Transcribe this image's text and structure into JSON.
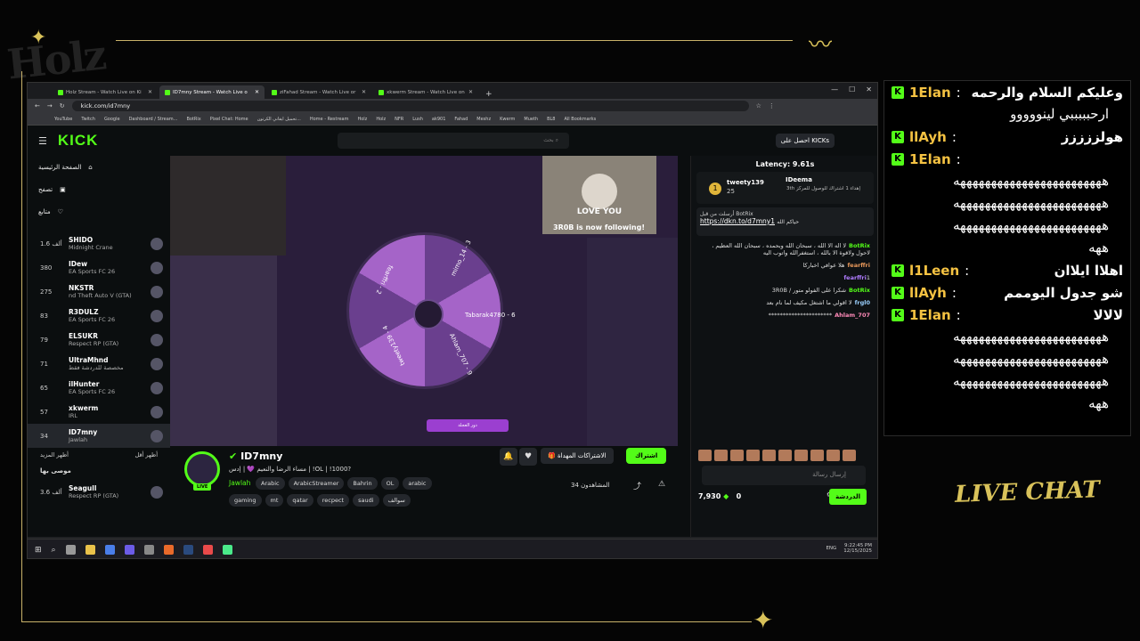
{
  "overlay_brand": {
    "logo_text": "Holz",
    "live_chat_label": "LIVE CHAT"
  },
  "browser": {
    "tabs": [
      {
        "label": "Holz Stream - Watch Live on Ki"
      },
      {
        "label": "ID7mny Stream - Watch Live o"
      },
      {
        "label": "ziFahad Stream - Watch Live or"
      },
      {
        "label": "xkwerm Stream - Watch Live on"
      }
    ],
    "url": "kick.com/id7mny",
    "bookmarks": [
      "YouTube",
      "Twitch",
      "Google",
      "Dashboard / Stream...",
      "BotRix",
      "Pixel Chat: Home",
      "تحميل ايقاني الكرتون...",
      "Home - Restream",
      "Holz",
      "Holz",
      "NFR",
      "Lush",
      "ak901",
      "Fahad",
      "Meshz",
      "Kwerm",
      "Mueth",
      "BL8",
      "All Bookmarks"
    ]
  },
  "kick": {
    "logo": "KICK",
    "search_placeholder": "بحث",
    "get_kicks": "احصل على KICKs",
    "nav": [
      {
        "label": "الصفحة الرئيسية",
        "icon": "home-icon"
      },
      {
        "label": "تصفح",
        "icon": "browse-icon"
      },
      {
        "label": "متابع",
        "icon": "heart-icon"
      }
    ],
    "following_channels": [
      {
        "name": "SHIDO",
        "game": "Midnight Crane",
        "viewers": "1.6 ألف"
      },
      {
        "name": "IDew",
        "game": "EA Sports FC 26",
        "viewers": "380"
      },
      {
        "name": "NKSTR",
        "game": "nd Theft Auto V (GTA)",
        "viewers": "275"
      },
      {
        "name": "R3DULZ",
        "game": "EA Sports FC 26",
        "viewers": "83"
      },
      {
        "name": "ELSUKR",
        "game": "Respect RP (GTA)",
        "viewers": "79"
      },
      {
        "name": "UltraMhnd",
        "game": "مخصصة للدردشة فقط",
        "viewers": "71"
      },
      {
        "name": "ilHunter",
        "game": "EA Sports FC 26",
        "viewers": "65"
      },
      {
        "name": "xkwerm",
        "game": "IRL",
        "viewers": "57"
      },
      {
        "name": "ID7mny",
        "game": "Jawlah",
        "viewers": "34"
      }
    ],
    "show_more": "أظهر المزيد",
    "show_less": "أظهر أقل",
    "recommended_label": "موصى بها",
    "recommended": [
      {
        "name": "Seagull",
        "game": "Respect RP (GTA)",
        "viewers": "3.6 ألف"
      }
    ],
    "video": {
      "cat_caption": "LOVE YOU",
      "follow_alert": "3R0B is now following!",
      "wheel_segments": [
        "mimo_14 - 3",
        "Tabarak4780 - 6",
        "Ahlam_707 - 9",
        "tweety139 - 4",
        "fearffri - 2"
      ],
      "spin_button": "دور العجلة"
    },
    "stream": {
      "channel_name": "ID7mny",
      "live_badge": "LIVE",
      "title": "مساء الرضا والنعيم 💜 | إدس | !OL | !1000?",
      "category": "Jawlah",
      "tags": [
        "Arabic",
        "ArabicStreamer",
        "Bahrin",
        "OL",
        "arabic",
        "gaming",
        "mt",
        "qatar",
        "recpect",
        "saudi",
        "سوالف"
      ],
      "subscribe": "اشتراك",
      "gift_subs": "الاشتراكات المهداة",
      "viewers": "34 المشاهدون"
    },
    "chat": {
      "latency": "Latency: 9.61s",
      "leaderboard": {
        "first": "tweety139",
        "first_count": "25",
        "second": "IDeema",
        "second_note": "إهداء 1 اشتراك للوصول للمركز 3th",
        "rank": "1"
      },
      "pinned_by": "أرسلت من قبل BotRix",
      "pinned_link": "https://dkn.to/d7mny1",
      "pinned_suffix": "حياكم الله",
      "messages": [
        {
          "user": "BotRix",
          "text": "لا اله الا الله ، سبحان الله وبحمده ، سبحان الله العظيم ، لاحول ولاقوة الا بالله ، استغفرالله واتوب اليه",
          "color": "#53fc18"
        },
        {
          "user": "fearffri",
          "text": "هلا عوافي اخباركا",
          "color": "#e8985a"
        },
        {
          "user": "fearffri",
          "text": "1",
          "color": "#b07cff"
        },
        {
          "user": "BotRix",
          "text": "شكرا على الفولو متور / 3R0B",
          "color": "#53fc18"
        },
        {
          "user": "frgl0",
          "text": "لا اقولي ما اشتغل مكيف لما نام بعد",
          "color": "#9ad0ff"
        },
        {
          "user": "Ahlam_707",
          "text": "**********************",
          "color": "#ff8ab8"
        }
      ],
      "input_placeholder": "إرسال رسالة",
      "points": "7,930",
      "zero": "0",
      "chat_button": "الدردشة"
    }
  },
  "taskbar": {
    "lang": "ENG",
    "time": "9:22:45 PM",
    "date": "12/15/2025"
  },
  "overlay_chat": [
    {
      "type": "msg",
      "user": "1Elan",
      "text": "وعليكم السلام والرحمه"
    },
    {
      "type": "cont",
      "text": "ارحبببببي لينووووو"
    },
    {
      "type": "msg",
      "user": "llAyh",
      "text": "هولززززز"
    },
    {
      "type": "msg",
      "user": "1Elan",
      "text": ""
    },
    {
      "type": "cont",
      "text": "ههههههههههههههههههههههههه"
    },
    {
      "type": "cont",
      "text": "ههههههههههههههههههههههههه"
    },
    {
      "type": "cont",
      "text": "ههههههههههههههههههههههههه"
    },
    {
      "type": "cont",
      "text": "ههه"
    },
    {
      "type": "msg",
      "user": "l1Leen",
      "text": "اهلاا ايلاان"
    },
    {
      "type": "msg",
      "user": "llAyh",
      "text": "شو جدول اليوممم"
    },
    {
      "type": "msg",
      "user": "1Elan",
      "text": "لالالا"
    },
    {
      "type": "cont",
      "text": "ههههههههههههههههههههههههه"
    },
    {
      "type": "cont",
      "text": "ههههههههههههههههههههههههه"
    },
    {
      "type": "cont",
      "text": "ههههههههههههههههههههههههه"
    },
    {
      "type": "cont",
      "text": "ههه"
    }
  ]
}
